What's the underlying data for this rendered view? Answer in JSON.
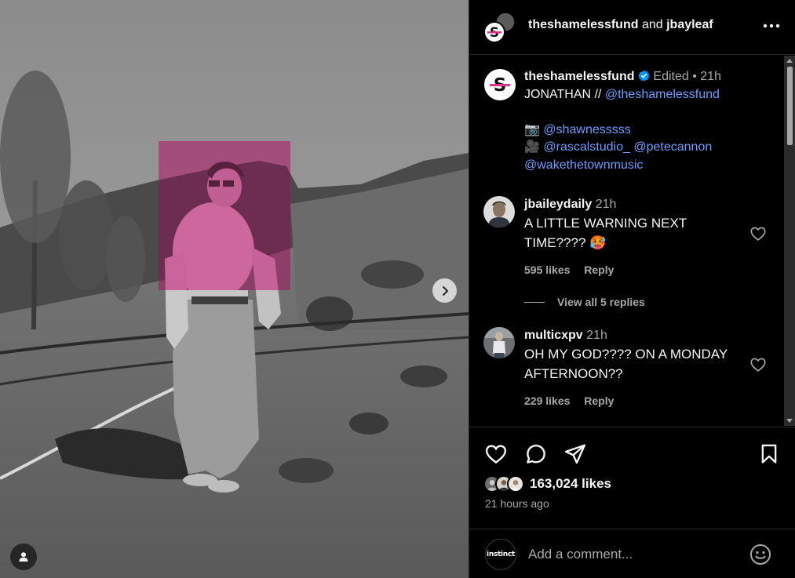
{
  "header": {
    "account": "theshamelessfund",
    "joiner": "and",
    "collaborator": "jbayleaf"
  },
  "caption": {
    "username": "theshamelessfund",
    "edited": "Edited",
    "separator": "•",
    "time": "21h",
    "line1_text": "JONATHAN //",
    "line1_mention": "@theshamelessfund",
    "photo_emoji": "📷",
    "photo_credit": "@shawnesssss",
    "video_emoji": "🎥",
    "video_credit_1": "@rascalstudio_",
    "video_credit_2": "@petecannon",
    "music_credit": "@wakethetownmusic"
  },
  "comments": [
    {
      "username": "jbaileydaily",
      "time": "21h",
      "text": "A LITTLE WARNING NEXT TIME???? 🥵",
      "likes": "595 likes",
      "reply": "Reply"
    },
    {
      "username": "multicxpv",
      "time": "21h",
      "text": "OH MY GOD???? ON A MONDAY AFTERNOON??",
      "likes": "229 likes",
      "reply": "Reply"
    }
  ],
  "view_replies": "View all 5 replies",
  "likes_count": "163,024 likes",
  "posted_ago": "21 hours ago",
  "add_comment": {
    "avatar_text": "instinct",
    "placeholder": "Add a comment..."
  },
  "colors": {
    "background": "#000000",
    "text": "#f5f5f5",
    "secondary_text": "#a8a8a8",
    "link": "#6e9cff",
    "verified": "#0095f6",
    "overlay_pink": "#e0338f",
    "divider": "#262626"
  },
  "icons": [
    "chevron-right-icon",
    "person-tag-icon",
    "more-icon",
    "verified-badge-icon",
    "heart-icon",
    "comment-icon",
    "share-icon",
    "bookmark-icon",
    "emoji-icon"
  ]
}
